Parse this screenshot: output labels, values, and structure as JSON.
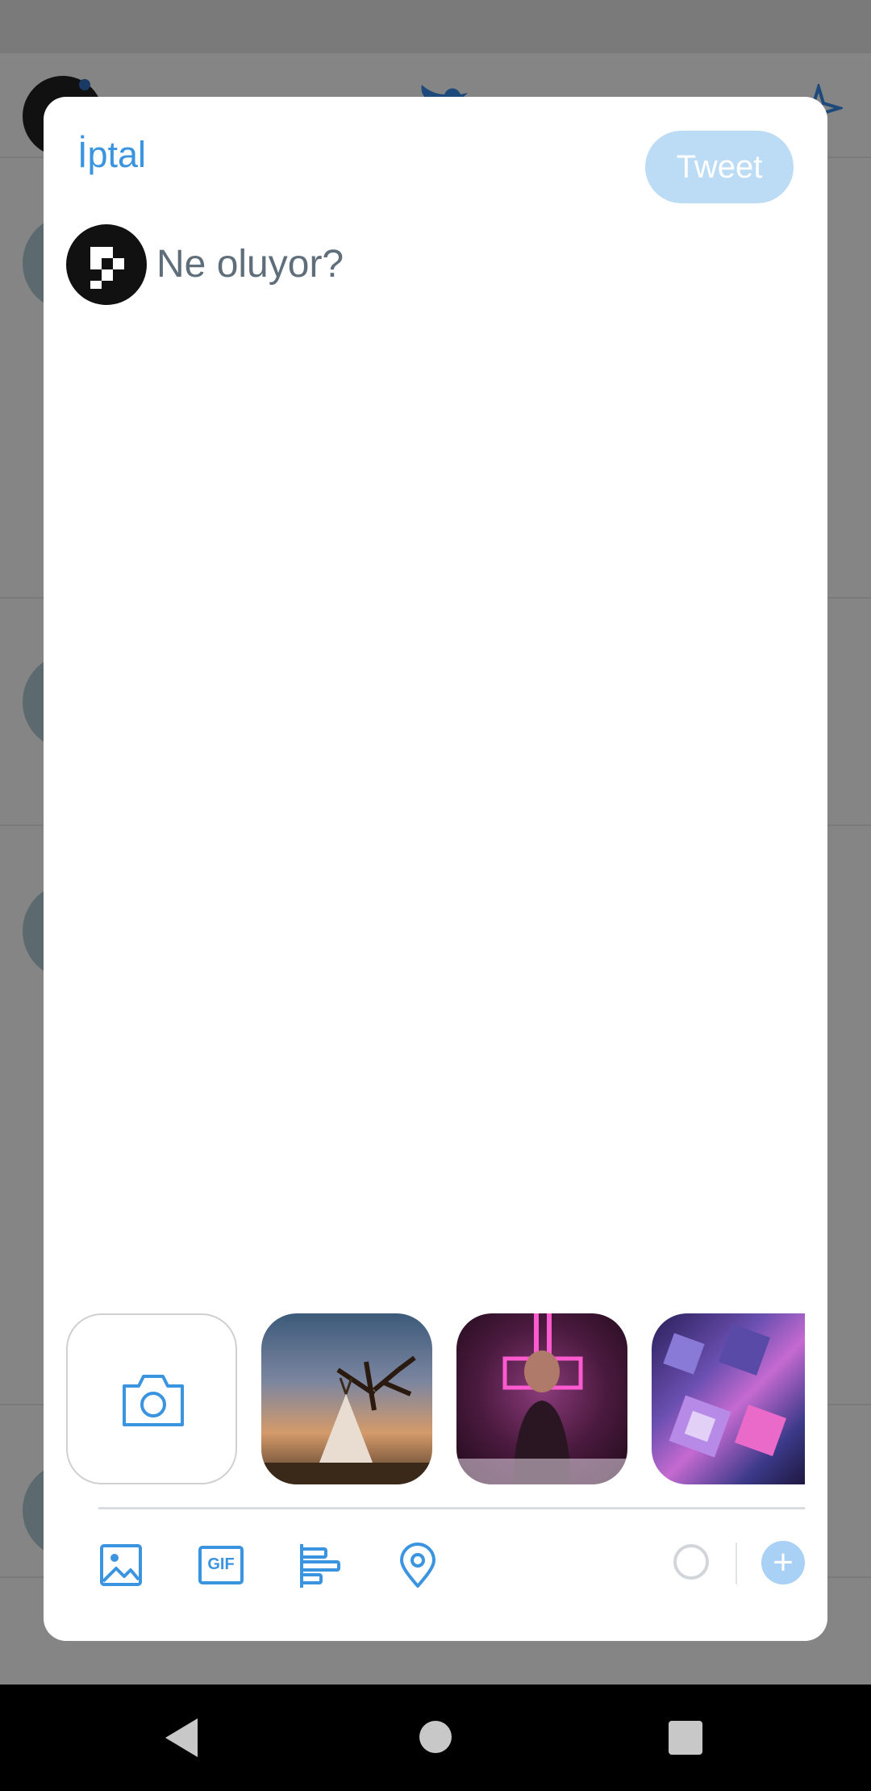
{
  "compose": {
    "cancel_label": "İptal",
    "tweet_label": "Tweet",
    "placeholder": "Ne oluyor?"
  },
  "media": {
    "icons": [
      "camera-icon"
    ],
    "thumbnails": [
      "tipi-desert-photo",
      "neon-portrait-photo",
      "city-aerial-photo"
    ]
  },
  "toolbar": {
    "icons": [
      "image-icon",
      "gif-icon",
      "poll-icon",
      "location-icon",
      "progress-ring-icon",
      "plus-icon"
    ],
    "gif_text": "GIF"
  },
  "colors": {
    "accent": "#3b94e0",
    "tweet_button_disabled": "#bcdcf6",
    "placeholder_text": "#5e6e7a",
    "scrim": "#7b7b7b"
  }
}
